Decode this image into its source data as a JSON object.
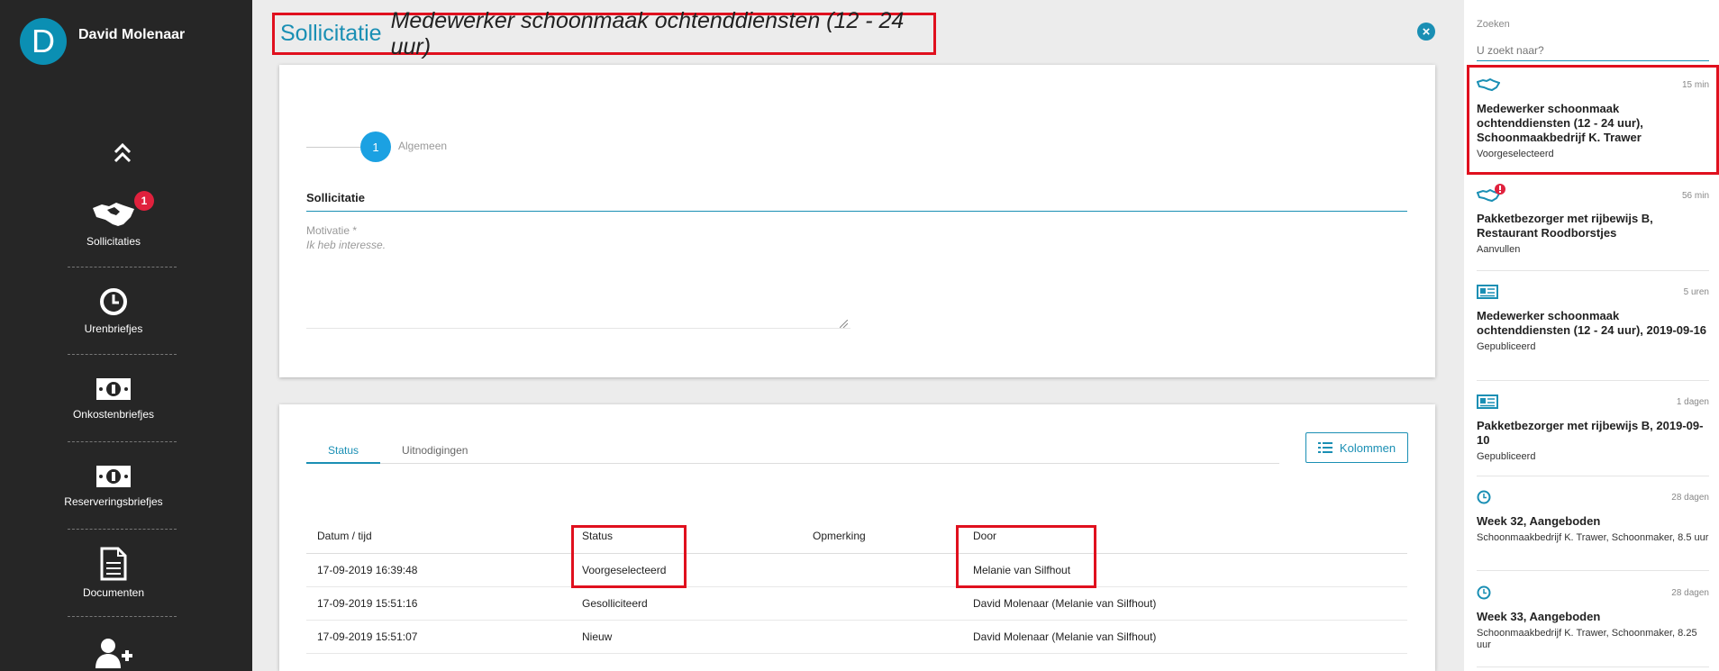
{
  "user": {
    "initial": "D",
    "name": "David Molenaar"
  },
  "colors": {
    "accent": "#1a8fb4",
    "highlight": "#e0101e",
    "badge": "#e0213d",
    "sidebar": "#262626"
  },
  "nav": [
    {
      "label": "Sollicitaties",
      "icon": "handshake-icon",
      "badge": "1"
    },
    {
      "label": "Urenbriefjes",
      "icon": "clock-icon"
    },
    {
      "label": "Onkostenbriefjes",
      "icon": "money-icon"
    },
    {
      "label": "Reserveringsbriefjes",
      "icon": "money-icon"
    },
    {
      "label": "Documenten",
      "icon": "document-icon"
    },
    {
      "label": "",
      "icon": "add-user-icon"
    }
  ],
  "header": {
    "type": "Sollicitatie",
    "title": "Medewerker schoonmaak ochtenddiensten (12 - 24 uur)"
  },
  "form": {
    "step_number": "1",
    "step_label": "Algemeen",
    "section_title": "Sollicitatie",
    "motivation_label": "Motivatie *",
    "motivation_value": "Ik heb interesse."
  },
  "history": {
    "tabs": [
      "Status",
      "Uitnodigingen"
    ],
    "columns_button": "Kolommen",
    "headers": [
      "Datum / tijd",
      "Status",
      "Opmerking",
      "Door"
    ],
    "rows": [
      [
        "17-09-2019 16:39:48",
        "Voorgeselecteerd",
        "",
        "Melanie van Silfhout"
      ],
      [
        "17-09-2019 15:51:16",
        "Gesolliciteerd",
        "",
        "David Molenaar (Melanie van Silfhout)"
      ],
      [
        "17-09-2019 15:51:07",
        "Nieuw",
        "",
        "David Molenaar (Melanie van Silfhout)"
      ]
    ]
  },
  "search": {
    "label": "Zoeken",
    "placeholder": "U zoekt naar?"
  },
  "feed": [
    {
      "icon": "handshake-icon",
      "time": "15 min",
      "title": "Medewerker schoonmaak ochtenddiensten (12 - 24 uur), Schoonmaakbedrijf K. Trawer",
      "subtitle": "Voorgeselecteerd"
    },
    {
      "icon": "handshake-alert-icon",
      "time": "56 min",
      "title": "Pakketbezorger met rijbewijs B, Restaurant Roodborstjes",
      "subtitle": "Aanvullen"
    },
    {
      "icon": "newspaper-icon",
      "time": "5 uren",
      "title": "Medewerker schoonmaak ochtenddiensten (12 - 24 uur), 2019-09-16",
      "subtitle": "Gepubliceerd"
    },
    {
      "icon": "newspaper-icon",
      "time": "1 dagen",
      "title": "Pakketbezorger met rijbewijs B, 2019-09-10",
      "subtitle": "Gepubliceerd"
    },
    {
      "icon": "clock-icon",
      "time": "28 dagen",
      "title": "Week 32, Aangeboden",
      "subtitle": "Schoonmaakbedrijf K. Trawer, Schoonmaker, 8.5 uur"
    },
    {
      "icon": "clock-icon",
      "time": "28 dagen",
      "title": "Week 33, Aangeboden",
      "subtitle": "Schoonmaakbedrijf K. Trawer, Schoonmaker, 8.25 uur"
    }
  ]
}
